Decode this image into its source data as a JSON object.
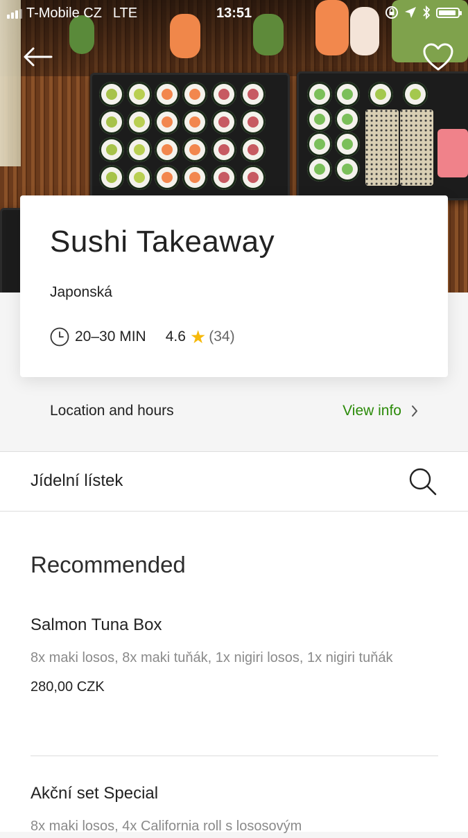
{
  "status_bar": {
    "carrier": "T-Mobile CZ",
    "network": "LTE",
    "time": "13:51"
  },
  "restaurant": {
    "name": "Sushi Takeaway",
    "cuisine": "Japonská",
    "delivery_time": "20–30 MIN",
    "rating": "4.6",
    "rating_count": "(34)"
  },
  "location": {
    "label": "Location and hours",
    "action": "View info"
  },
  "menu": {
    "label": "Jídelní lístek"
  },
  "sections": [
    {
      "title": "Recommended",
      "items": [
        {
          "name": "Salmon Tuna Box",
          "description": "8x maki losos, 8x maki tuňák, 1x nigiri losos, 1x nigiri tuňák",
          "price": "280,00 CZK"
        },
        {
          "name": "Akční set Special",
          "description": "8x maki losos, 4x California roll s lososovým"
        }
      ]
    }
  ],
  "colors": {
    "accent_green": "#2a8a08",
    "star": "#f6b90b"
  },
  "icons": {
    "back": "arrow-left",
    "favorite": "heart-outline",
    "clock": "clock",
    "search": "magnifier",
    "chevron": "chevron-right"
  }
}
